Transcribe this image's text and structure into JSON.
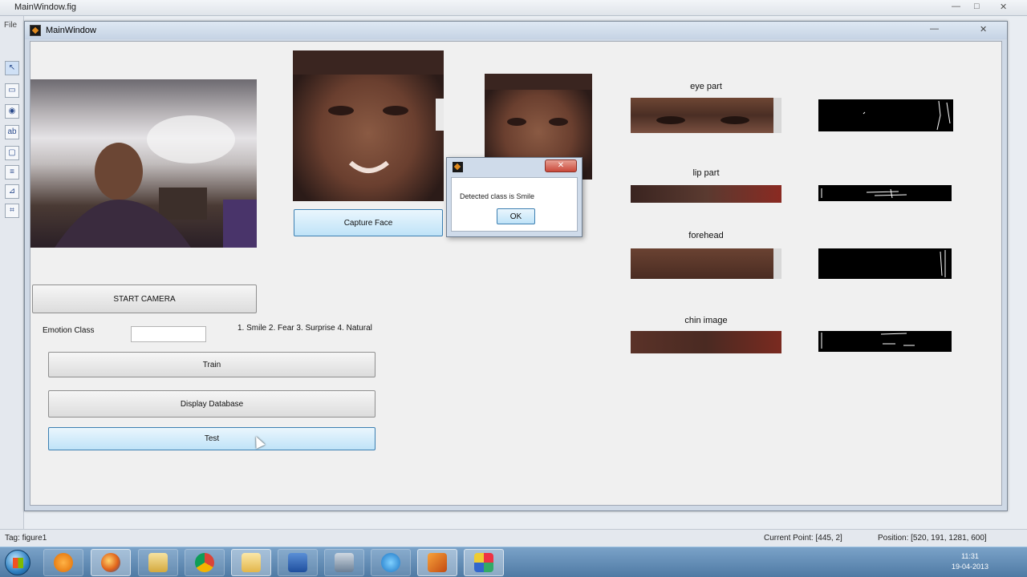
{
  "outer": {
    "title": "MainWindow.fig",
    "menu_file": "File",
    "controls": [
      "—",
      "□",
      "✕"
    ]
  },
  "window": {
    "title": "MainWindow",
    "controls": [
      "—",
      "✕"
    ]
  },
  "left_panel": {
    "start_camera_label": "START CAMERA",
    "emotion_class_label": "Emotion Class",
    "emotion_class_value": "",
    "emotion_legend": "1. Smile 2. Fear 3. Surprise 4. Natural",
    "train_label": "Train",
    "display_database_label": "Display Database",
    "test_label": "Test"
  },
  "capture": {
    "capture_face_label": "Capture Face"
  },
  "features": {
    "eye_part": "eye part",
    "lip_part": "lip part",
    "forehead": "forehead",
    "chin_image": "chin image"
  },
  "dialog": {
    "message": "Detected class is Smile",
    "ok_label": "OK"
  },
  "status": {
    "tag": "Tag: figure1",
    "current_point": "Current Point:  [445, 2]",
    "position": "Position: [520, 191, 1281, 600]"
  },
  "taskbar": {
    "apps": [
      "media-player",
      "firefox",
      "explorer",
      "chrome",
      "folder",
      "word",
      "network",
      "internet-explorer",
      "matlab",
      "guide"
    ],
    "clock_time": "11:31",
    "clock_date": "19-04-2013"
  },
  "colors": {
    "accent_blue": "#bfe3f8",
    "dialog_close": "#c9483a"
  }
}
